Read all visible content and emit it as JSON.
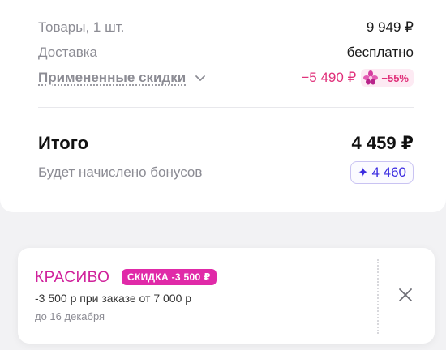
{
  "summary": {
    "goods_label": "Товары, 1 шт.",
    "goods_value": "9 949 ₽",
    "delivery_label": "Доставка",
    "delivery_value": "бесплатно",
    "discounts_label": "Примененные скидки",
    "discounts_amount": "−5 490 ₽",
    "discounts_percent": "−55%",
    "total_label": "Итого",
    "total_value": "4 459 ₽",
    "bonus_label": "Будет начислено бонусов",
    "bonus_value": "4 460"
  },
  "promo": {
    "code": "КРАСИВО",
    "badge": "СКИДКА -3 500 ₽",
    "condition": "-3 500 р при заказе от 7 000 р",
    "valid_until": "до 16 декабря"
  },
  "colors": {
    "accent_pink": "#e0307a",
    "promo_magenta": "#d0219b",
    "bonus_blue": "#3a2be0"
  },
  "icons": {
    "chevron": "chevron-down-icon",
    "orchid": "orchid-icon",
    "star": "sparkle-icon",
    "close": "close-icon"
  }
}
